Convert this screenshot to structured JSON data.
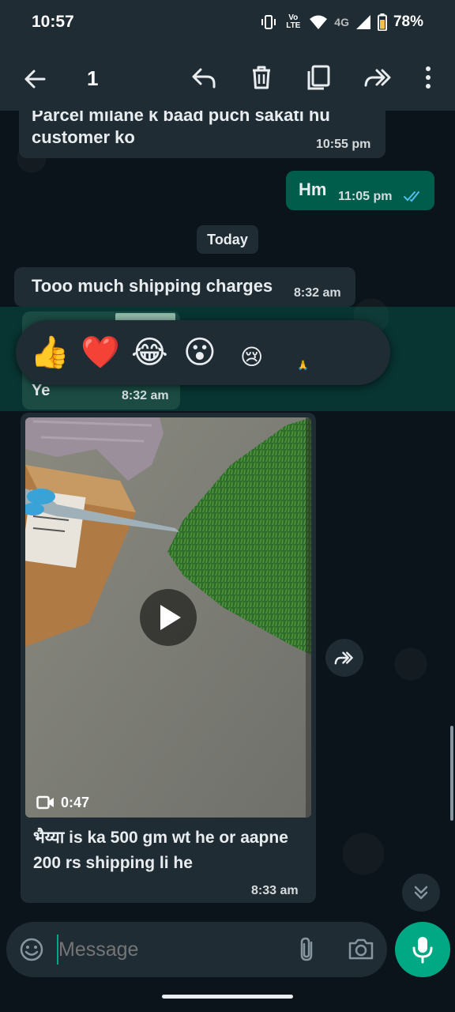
{
  "status_bar": {
    "time": "10:57",
    "volte": "Vo LTE",
    "network": "4G",
    "battery": "78%"
  },
  "app_bar": {
    "selected_count": "1"
  },
  "messages": {
    "m1_text": "Parcel milane k baad puch sakati hu customer ko",
    "m1_time": "10:55 pm",
    "m2_text": "Hm",
    "m2_time": "11:05 pm",
    "date_chip": "Today",
    "m3_text": "Tooo much shipping charges",
    "m3_time": "8:32 am",
    "m4_text": "Ye",
    "m4_time": "8:32 am",
    "video_duration": "0:47",
    "m5_caption": "भैय्या is  ka   500 gm wt he or aapne 200 rs shipping li he",
    "m5_time": "8:33 am"
  },
  "reactions": [
    "👍",
    "❤️",
    "😂",
    "😮",
    "😢",
    "🙏"
  ],
  "composer": {
    "placeholder": "Message"
  },
  "colors": {
    "accent": "#00a884",
    "outgoing_bubble": "#005c4b",
    "incoming_bubble": "#1f2c34",
    "background": "#0b141a"
  },
  "icons": [
    "back-arrow-icon",
    "reply-icon",
    "delete-icon",
    "copy-icon",
    "forward-icon",
    "more-vert-icon",
    "emoji-icon",
    "attach-icon",
    "camera-icon",
    "mic-icon",
    "play-icon",
    "video-camera-icon",
    "scroll-down-icon"
  ]
}
